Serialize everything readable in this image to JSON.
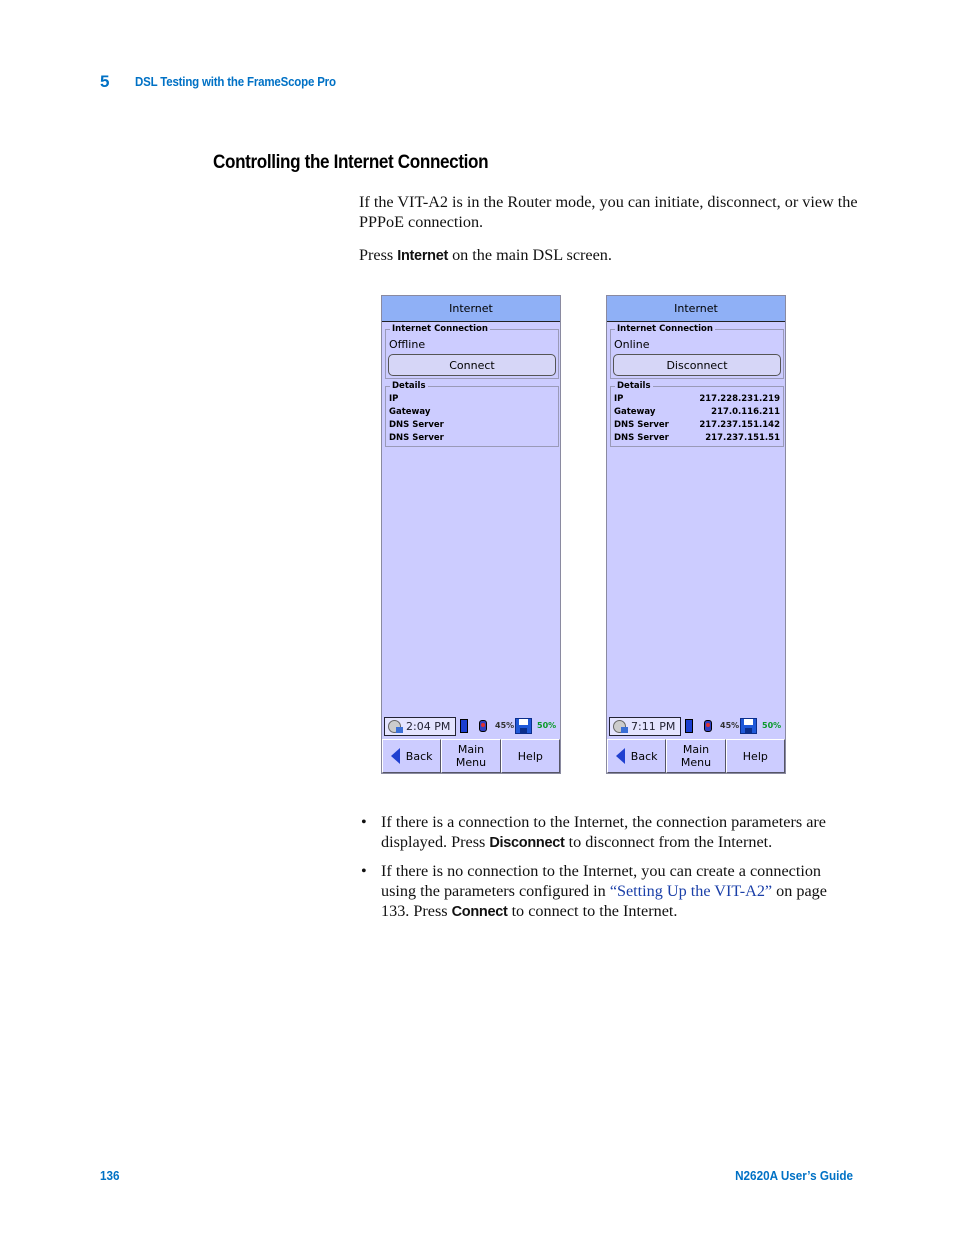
{
  "header": {
    "chapter_number": "5",
    "chapter_title": "DSL Testing with the FrameScope Pro"
  },
  "section": {
    "title": "Controlling the Internet Connection"
  },
  "intro": {
    "text": "If the VIT-A2 is in the Router mode, you can initiate, disconnect, or view the PPPoE connection.",
    "press_prefix": "Press ",
    "press_keyword": "Internet",
    "press_suffix": " on the main DSL screen."
  },
  "screens": [
    {
      "title": "Internet",
      "connection_group_label": "Internet Connection",
      "status": "Offline",
      "action_button": "Connect",
      "details_group_label": "Details",
      "details": [
        {
          "label": "IP",
          "value": ""
        },
        {
          "label": "Gateway",
          "value": ""
        },
        {
          "label": "DNS Server",
          "value": ""
        },
        {
          "label": "DNS Server",
          "value": ""
        }
      ],
      "statusbar": {
        "time": "2:04 PM",
        "battery_percent": "45%",
        "storage_percent": "50%"
      },
      "softkeys": {
        "back": "Back",
        "main_menu_line1": "Main",
        "main_menu_line2": "Menu",
        "help": "Help"
      }
    },
    {
      "title": "Internet",
      "connection_group_label": "Internet Connection",
      "status": "Online",
      "action_button": "Disconnect",
      "details_group_label": "Details",
      "details": [
        {
          "label": "IP",
          "value": "217.228.231.219"
        },
        {
          "label": "Gateway",
          "value": "217.0.116.211"
        },
        {
          "label": "DNS Server",
          "value": "217.237.151.142"
        },
        {
          "label": "DNS Server",
          "value": "217.237.151.51"
        }
      ],
      "statusbar": {
        "time": "7:11 PM",
        "battery_percent": "45%",
        "storage_percent": "50%"
      },
      "softkeys": {
        "back": "Back",
        "main_menu_line1": "Main",
        "main_menu_line2": "Menu",
        "help": "Help"
      }
    }
  ],
  "bullets": [
    {
      "bullet": "•",
      "text_before": "If there is a connection to the Internet, the connection parameters are displayed. Press ",
      "keyword": "Disconnect",
      "text_after": " to disconnect from the Internet."
    },
    {
      "bullet": "•",
      "text_before": "If there is no connection to the Internet, you can create a connection using the parameters configured in ",
      "link": "“Setting Up the VIT-A2”",
      "text_middle": " on page 133. Press ",
      "keyword": "Connect",
      "text_after": " to connect to the Internet."
    }
  ],
  "footer": {
    "page_number": "136",
    "guide_title": "N2620A User’s Guide"
  },
  "colors": {
    "accent_blue": "#0071c5",
    "link_blue": "#1a3fa8",
    "screen_bg": "#ccccff",
    "titlebar_bg": "#8fb0f6",
    "storage_green": "#0a9a2a"
  }
}
